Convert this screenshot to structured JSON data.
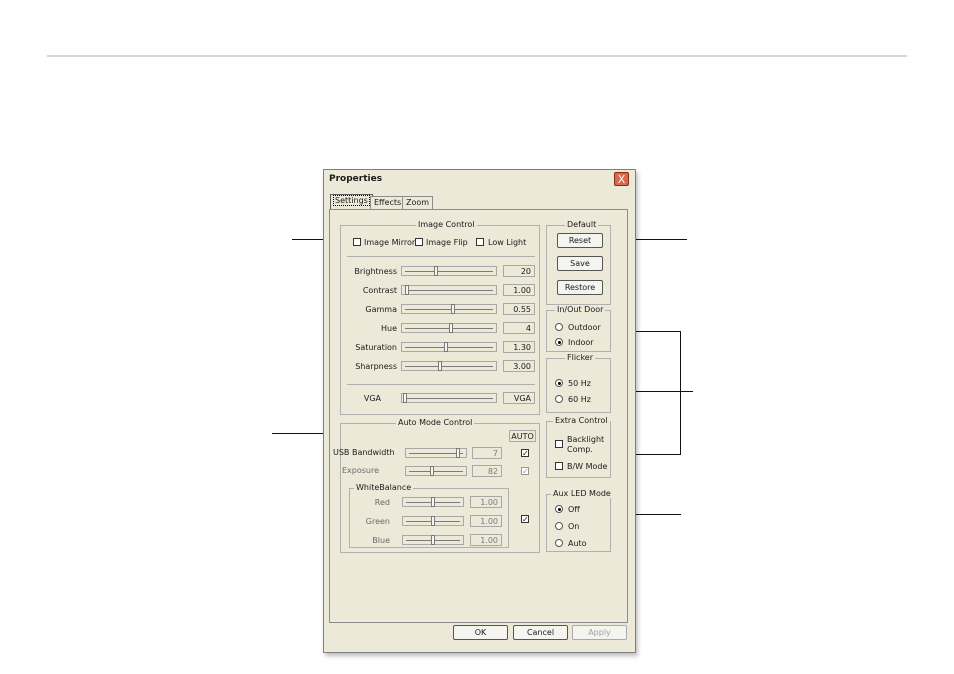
{
  "window": {
    "title": "Properties",
    "close": "X"
  },
  "tabs": [
    {
      "label": "Settings",
      "active": true
    },
    {
      "label": "Effects"
    },
    {
      "label": "Zoom"
    }
  ],
  "image_control": {
    "label": "Image Control",
    "checkboxes": [
      {
        "label": "Image Mirror",
        "checked": false
      },
      {
        "label": "Image Flip",
        "checked": false
      },
      {
        "label": "Low Light",
        "checked": false
      }
    ],
    "sliders": [
      {
        "label": "Brightness",
        "value": "20",
        "fraction": 0.35
      },
      {
        "label": "Contrast",
        "value": "1.00",
        "fraction": 0.02
      },
      {
        "label": "Gamma",
        "value": "0.55",
        "fraction": 0.55
      },
      {
        "label": "Hue",
        "value": "4",
        "fraction": 0.52
      },
      {
        "label": "Saturation",
        "value": "1.30",
        "fraction": 0.47
      },
      {
        "label": "Sharpness",
        "value": "3.00",
        "fraction": 0.4
      }
    ],
    "resolution": {
      "label": "VGA",
      "value": "VGA",
      "fraction": 0.02
    }
  },
  "default": {
    "label": "Default",
    "buttons": [
      "Reset",
      "Save",
      "Restore"
    ]
  },
  "in_out_door": {
    "label": "In/Out Door",
    "options": [
      {
        "label": "Outdoor",
        "selected": false
      },
      {
        "label": "Indoor",
        "selected": true
      }
    ]
  },
  "flicker": {
    "label": "Flicker",
    "options": [
      {
        "label": "50 Hz",
        "selected": true
      },
      {
        "label": "60 Hz",
        "selected": false
      }
    ]
  },
  "extra_control": {
    "label": "Extra Control",
    "items": [
      {
        "label": "Backlight\nComp.",
        "line1": "Backlight",
        "line2": "Comp.",
        "checked": false
      },
      {
        "label": "B/W Mode",
        "checked": false
      }
    ]
  },
  "aux_led": {
    "label": "Aux LED Mode",
    "options": [
      {
        "label": "Off",
        "selected": true
      },
      {
        "label": "On",
        "selected": false
      },
      {
        "label": "Auto",
        "selected": false
      }
    ]
  },
  "auto_mode": {
    "label": "Auto Mode Control",
    "auto_header": "AUTO",
    "usb": {
      "label": "USB Bandwidth",
      "value": "7",
      "fraction": 0.85,
      "auto": true
    },
    "exposure": {
      "label": "Exposure",
      "value": "82",
      "fraction": 0.4,
      "auto": true
    },
    "white_balance": {
      "label": "WhiteBalance",
      "auto": true,
      "channels": [
        {
          "label": "Red",
          "value": "1.00",
          "fraction": 0.5
        },
        {
          "label": "Green",
          "value": "1.00",
          "fraction": 0.5
        },
        {
          "label": "Blue",
          "value": "1.00",
          "fraction": 0.5
        }
      ]
    }
  },
  "footer": {
    "ok": "OK",
    "cancel": "Cancel",
    "apply": "Apply"
  }
}
